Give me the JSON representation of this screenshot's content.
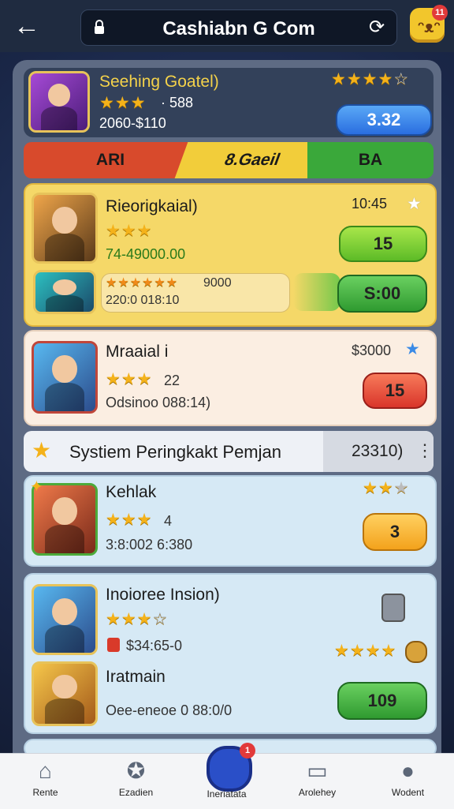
{
  "header": {
    "title": "Cashiabn G Com",
    "back_icon": "back-arrow-icon",
    "badge_count": "11"
  },
  "top_card": {
    "name": "Seehing Goatel)",
    "rating_text": "· 588",
    "price_range": "2060-$110",
    "button_label": "3.32",
    "stars": 4
  },
  "ribbon": {
    "left": "ARI",
    "middle": "8.Gaeil",
    "right": "BA"
  },
  "card1": {
    "name": "Rieorigkaial)",
    "score": "10:45",
    "date": "74-49000.00",
    "button_label": "15",
    "stars": 3
  },
  "card1_row2": {
    "stars_text": "★★★★★★",
    "value": "9000",
    "date": "220:0 018:10",
    "button_label": "S:00"
  },
  "card2": {
    "name": "Mraaial i",
    "score": "$3000",
    "stars_text": "22",
    "subtitle": "Odsinoo 088:14)",
    "button_label": "15",
    "stars": 3
  },
  "section": {
    "title": "Systiem Peringkakt Pemjan",
    "right_text": "23310)"
  },
  "card3": {
    "name": "Kehlak",
    "rating_text": "4",
    "subtitle": "3:8:002 6:380",
    "button_label": "3",
    "stars": 3
  },
  "card4": {
    "name": "Inoioree Insion)",
    "subtitle": "$34:65-0",
    "stars": 3
  },
  "card5": {
    "name": "Iratmain",
    "subtitle": "Oee-eneoe 0 88:0/0",
    "button_label": "109"
  },
  "navbar": {
    "items": [
      {
        "label": "Rente",
        "icon": "home-icon"
      },
      {
        "label": "Ezadien",
        "icon": "chart-icon"
      },
      {
        "label": "Ineriatata",
        "icon": "center-icon"
      },
      {
        "label": "Arolehey",
        "icon": "chat-icon"
      },
      {
        "label": "Wodent",
        "icon": "profile-icon"
      }
    ],
    "center_badge": "1"
  }
}
